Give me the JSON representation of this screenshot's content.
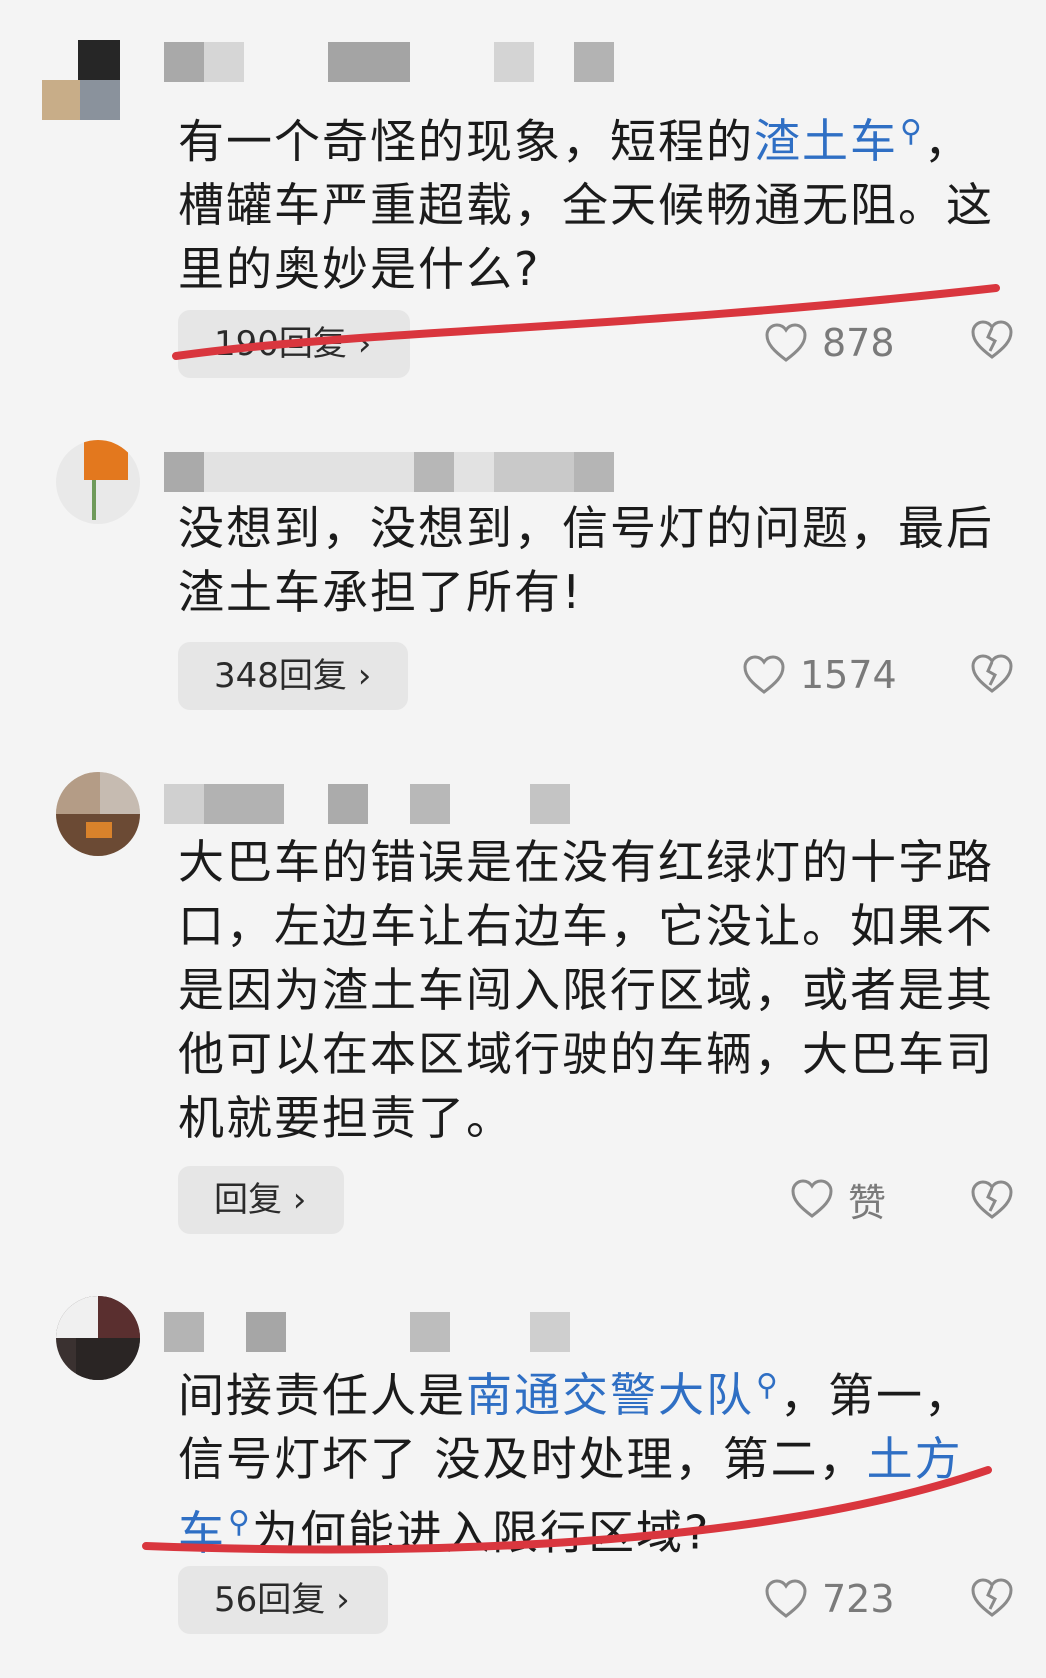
{
  "comments": [
    {
      "text_segments": [
        {
          "t": "有一个奇怪的现象，短程的",
          "kw": false
        },
        {
          "t": "渣土车",
          "kw": true
        },
        {
          "t": "，槽罐车严重超载，全天候畅通无阻。这里的奥妙是什么?",
          "kw": false
        }
      ],
      "reply_label": "190回复 ›",
      "like_count": "878"
    },
    {
      "text_segments": [
        {
          "t": "没想到，没想到，信号灯的问题，最后渣土车承担了所有!",
          "kw": false
        }
      ],
      "reply_label": "348回复 ›",
      "like_count": "1574"
    },
    {
      "text_segments": [
        {
          "t": "大巴车的错误是在没有红绿灯的十字路口，左边车让右边车，它没让。如果不是因为渣土车闯入限行区域，或者是其他可以在本区域行驶的车辆，大巴车司机就要担责了。",
          "kw": false
        }
      ],
      "reply_label": "回复 ›",
      "like_count": "赞"
    },
    {
      "text_segments": [
        {
          "t": "间接责任人是",
          "kw": false
        },
        {
          "t": "南通交警大队",
          "kw": true
        },
        {
          "t": "，第一，信号灯坏了 没及时处理，第二，",
          "kw": false
        },
        {
          "t": "土方车",
          "kw": true
        },
        {
          "t": "为何能进入限行区域?",
          "kw": false
        }
      ],
      "reply_label": "56回复 ›",
      "like_count": "723"
    }
  ],
  "icons": {
    "like": "heart-outline-icon",
    "dislike": "broken-heart-icon",
    "search": "search-icon"
  },
  "colors": {
    "keyword": "#2f6fc4",
    "annotation_line": "#d9363e",
    "reply_bg": "#e6e6e6",
    "meta_gray": "#7a7a7a"
  }
}
